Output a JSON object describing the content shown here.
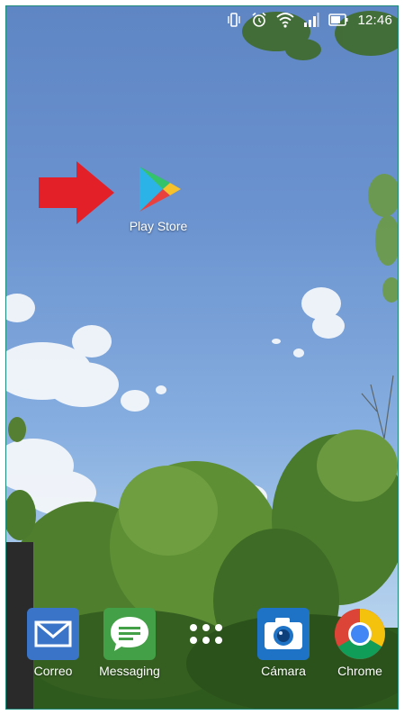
{
  "status_bar": {
    "time": "12:46",
    "icons": [
      "vibrate-icon",
      "alarm-icon",
      "wifi-icon",
      "signal-icon",
      "battery-icon"
    ]
  },
  "home": {
    "play_store_label": "Play Store"
  },
  "dock": {
    "items": [
      {
        "label": "Correo",
        "icon": "mail-icon"
      },
      {
        "label": "Messaging",
        "icon": "messaging-icon"
      },
      {
        "label": "",
        "icon": "app-drawer-icon"
      },
      {
        "label": "Cámara",
        "icon": "camera-icon"
      },
      {
        "label": "Chrome",
        "icon": "chrome-icon"
      }
    ]
  },
  "colors": {
    "frame_border": "#1e8b7a",
    "arrow": "#e32027",
    "sky": "#6b93cf",
    "mail_tile": "#3a74c9",
    "messaging_tile": "#43a047",
    "camera_tile": "#1f73c7"
  }
}
